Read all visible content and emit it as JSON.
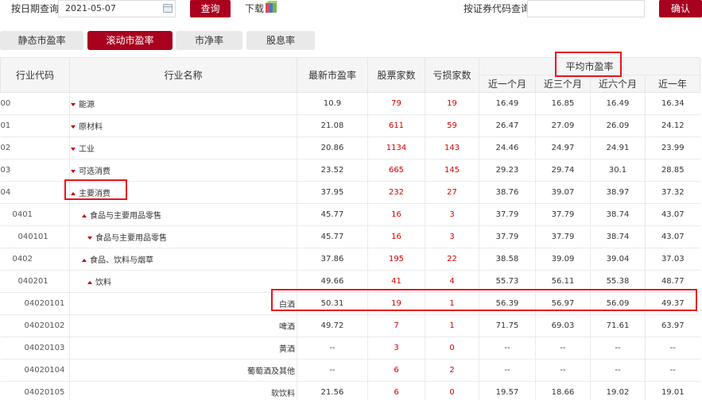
{
  "toolbar": {
    "date_label": "按日期查询",
    "date_value": "2021-05-07",
    "query_button": "查询",
    "download_label": "下载",
    "code_label": "按证券代码查询",
    "code_value": "",
    "confirm_button": "确认"
  },
  "tabs": [
    "静态市盈率",
    "滚动市盈率",
    "市净率",
    "股息率"
  ],
  "active_tab": "滚动市盈率",
  "table": {
    "headers": {
      "code": "行业代码",
      "name": "行业名称",
      "latest_pe": "最新市盈率",
      "stock_count": "股票家数",
      "loss_count": "亏损家数",
      "avg_group": "平均市盈率",
      "m1": "近一个月",
      "m3": "近三个月",
      "m6": "近六个月",
      "y1": "近一年"
    },
    "rows": [
      {
        "code": "00",
        "name": "能源",
        "arrow": "down",
        "pe": "10.9",
        "stocks": "79",
        "loss": "19",
        "m1": "16.49",
        "m3": "16.85",
        "m6": "16.49",
        "y1": "16.34"
      },
      {
        "code": "01",
        "name": "原材料",
        "arrow": "down",
        "pe": "21.08",
        "stocks": "611",
        "loss": "59",
        "m1": "26.47",
        "m3": "27.09",
        "m6": "26.09",
        "y1": "24.12"
      },
      {
        "code": "02",
        "name": "工业",
        "arrow": "down",
        "pe": "20.86",
        "stocks": "1134",
        "loss": "143",
        "m1": "24.46",
        "m3": "24.97",
        "m6": "24.91",
        "y1": "23.99"
      },
      {
        "code": "03",
        "name": "可选消费",
        "arrow": "down",
        "pe": "23.52",
        "stocks": "665",
        "loss": "145",
        "m1": "29.23",
        "m3": "29.74",
        "m6": "30.1",
        "y1": "28.85"
      },
      {
        "code": "04",
        "name": "主要消费",
        "arrow": "up",
        "pe": "37.95",
        "stocks": "232",
        "loss": "27",
        "m1": "38.76",
        "m3": "39.07",
        "m6": "38.97",
        "y1": "37.32"
      },
      {
        "code": "0401",
        "name": "食品与主要用品零售",
        "arrow": "up",
        "pe": "45.77",
        "stocks": "16",
        "loss": "3",
        "m1": "37.79",
        "m3": "37.79",
        "m6": "38.74",
        "y1": "43.07"
      },
      {
        "code": "040101",
        "name": "食品与主要用品零售",
        "arrow": "down",
        "pe": "45.77",
        "stocks": "16",
        "loss": "3",
        "m1": "37.79",
        "m3": "37.79",
        "m6": "38.74",
        "y1": "43.07"
      },
      {
        "code": "0402",
        "name": "食品、饮料与烟草",
        "arrow": "up",
        "pe": "37.86",
        "stocks": "195",
        "loss": "22",
        "m1": "38.58",
        "m3": "39.09",
        "m6": "39.04",
        "y1": "37.03"
      },
      {
        "code": "040201",
        "name": "饮料",
        "arrow": "up",
        "pe": "49.66",
        "stocks": "41",
        "loss": "4",
        "m1": "55.73",
        "m3": "56.11",
        "m6": "55.38",
        "y1": "48.77"
      },
      {
        "code": "04020101",
        "name": "白酒",
        "arrow": "",
        "pe": "50.31",
        "stocks": "19",
        "loss": "1",
        "m1": "56.39",
        "m3": "56.97",
        "m6": "56.09",
        "y1": "49.37"
      },
      {
        "code": "04020102",
        "name": "啤酒",
        "arrow": "",
        "pe": "49.72",
        "stocks": "7",
        "loss": "1",
        "m1": "71.75",
        "m3": "69.03",
        "m6": "71.61",
        "y1": "63.97"
      },
      {
        "code": "04020103",
        "name": "黄酒",
        "arrow": "",
        "pe": "--",
        "stocks": "3",
        "loss": "0",
        "m1": "--",
        "m3": "--",
        "m6": "--",
        "y1": "--"
      },
      {
        "code": "04020104",
        "name": "葡萄酒及其他",
        "arrow": "",
        "pe": "--",
        "stocks": "6",
        "loss": "2",
        "m1": "--",
        "m3": "--",
        "m6": "--",
        "y1": "--"
      },
      {
        "code": "04020105",
        "name": "软饮料",
        "arrow": "",
        "pe": "21.56",
        "stocks": "6",
        "loss": "0",
        "m1": "19.57",
        "m3": "18.66",
        "m6": "19.02",
        "y1": "19.01"
      }
    ]
  },
  "colors": {
    "accent": "#a8001e",
    "highlight": "#e8141f",
    "number_red": "#d40000",
    "header_bg": "#f5f5f5"
  }
}
